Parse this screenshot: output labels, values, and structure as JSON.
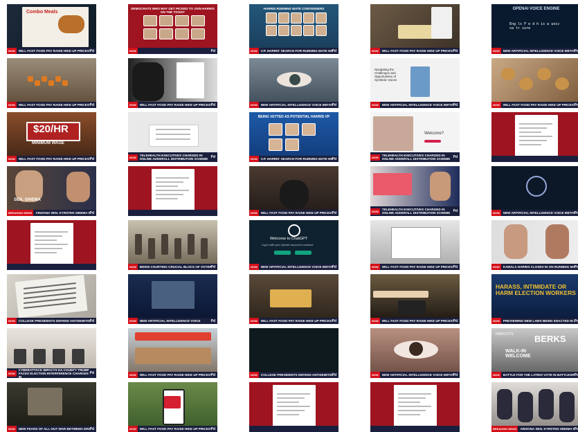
{
  "chyrons": {
    "fastfood": "WILL FAST FOOD PAY RAISE HIKE UP PRICES?",
    "democrats": "",
    "harrisSearch": "V.P. HARRIS' SEARCH FOR RUNNING MATE HEATS UP",
    "ai": "NEW ARTIFICIAL INTELLIGENCE VOICE IMITATION FEARS",
    "telehealth": "TELEHEALTH EXECUTIVES CHARGED IN ONLINE ADDERALL DISTRIBUTION SCHEME",
    "sinema": "ARIZONA SEN. KYRSTEN SINEMA NOT RUNNING FOR RE-ELECTION",
    "biden": "BIDEN COURTING CRUCIAL BLOCS OF VOTERS",
    "harrisClose": "KAMALA HARRIS CLOSES IN ON RUNNING MATE",
    "college": "COLLEGE PRESIDENTS DEFEND ANTISEMITISM RESPONSE",
    "aiShort": "NEW ARTIFICIAL INTELLIGENCE VOICE",
    "election": "PREVIEWING NEW LAWS BEING ENACTED IN 2024",
    "cyber": "CYBERATTACK IMPACTS DA COUNTY TRUMP FACES ELECTION INTERFERENCE CHARGES IN",
    "latino": "BATTLE FOR THE LATINO VOTE IN BATTLEGROUND PA",
    "israel": "NEW FEARS OF ALL-OUT WAR BETWEEN ISRAEL & HEZBOLLAH",
    "arizona": "ARIZONA SEN. KYRSTEN SINEMA NOT RUNNING FOR ELECTION"
  },
  "tags": {
    "now": "NOW",
    "breaking": "BREAKING NEWS"
  },
  "network": "Pd",
  "texts": {
    "combo": "Combo Meals",
    "democrats": "DEMOCRATS WHO MAY GET PICKED TO JOIN HARRIS ON THE TICKET",
    "contenders": "HARRIS RUNNING MATE CONTENDERS",
    "voiceEngine": "OPENAI VOICE ENGINE",
    "engineText": "Eng ls F e d h is a univ sa tr sure",
    "wage": "$20/HR",
    "wageSub": "MINIMUM WAGE",
    "vetted": "BEING VETTED AS POTENTIAL HARRIS VP",
    "welcome": "Welcome?",
    "sinema": "SEN. SINEMA",
    "chatgpt": "Welcome to ChatGPT",
    "chatgptSub": "Log in with your OpenAI account to continue",
    "navigating": "Navigating the Challenges and Opportunities of Synthetic Voices",
    "harass": "HARASS, INTIMIDATE OR HARM ELECTION WORKERS",
    "berks": "BERKS",
    "walkin": "WALK-IN WELCOME",
    "haircut": "HAIRCUTS"
  }
}
